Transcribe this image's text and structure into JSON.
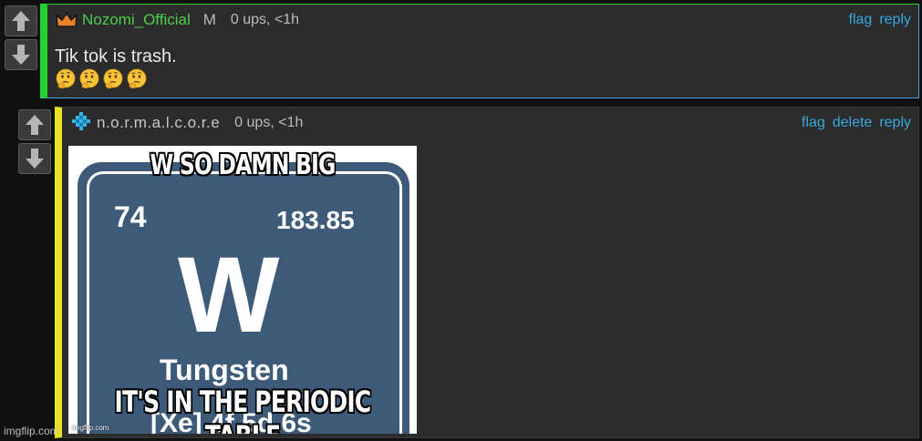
{
  "comments": [
    {
      "username": "Nozomi_Official",
      "badge_icon": "crown-icon",
      "mod_label": "M",
      "meta": "0 ups, <1h",
      "actions": [
        "flag",
        "reply"
      ],
      "text": "Tik tok is trash.",
      "emoji_icon": "thinking-face-emoji",
      "emoji_count": 4
    },
    {
      "username": "n.o.r.m.a.l.c.o.r.e",
      "badge_icon": "diamond-pixel-icon",
      "meta": "0 ups, <1h",
      "actions": [
        "flag",
        "delete",
        "reply"
      ],
      "meme": {
        "caption_top": "W SO DAMN BIG",
        "caption_bottom": "IT'S IN THE PERIODIC TABLE",
        "atomic_number": "74",
        "atomic_mass": "183.85",
        "symbol": "W",
        "name": "Tungsten",
        "config": "[Xe] 4f  5d  6s",
        "watermark": "imgflip.com"
      }
    }
  ],
  "page_watermark": "imgflip.com",
  "colors": {
    "accent_link": "#36a8df",
    "green_bar": "#22d32e",
    "yellow_bar": "#e8e21f",
    "username_green": "#4ccd4c"
  }
}
